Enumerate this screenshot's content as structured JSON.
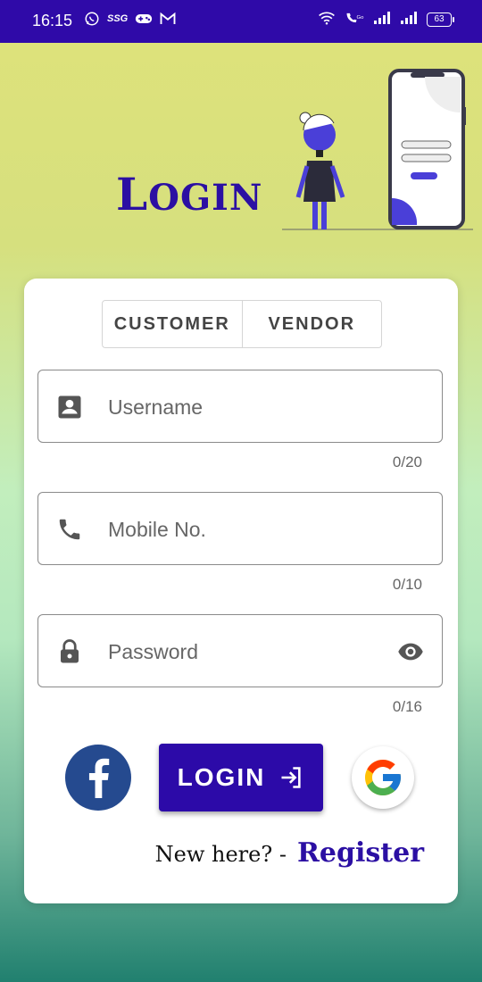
{
  "status_bar": {
    "time": "16:15",
    "left_icons": [
      "whatsapp-icon",
      "ssg-icon",
      "gamepad-icon",
      "gmail-icon"
    ],
    "ssg_text": "SSG",
    "battery": "63"
  },
  "header": {
    "title_first": "L",
    "title_rest": "OGIN"
  },
  "tabs": {
    "customer": "CUSTOMER",
    "vendor": "VENDOR"
  },
  "form": {
    "username": {
      "placeholder": "Username",
      "value": "",
      "counter": "0/20",
      "icon": "account-box-icon"
    },
    "mobile": {
      "placeholder": "Mobile No.",
      "value": "",
      "counter": "0/10",
      "icon": "phone-icon"
    },
    "password": {
      "placeholder": "Password",
      "value": "",
      "counter": "0/16",
      "icon": "lock-icon"
    }
  },
  "actions": {
    "login_label": "LOGIN",
    "new_here": "New here? -",
    "register": "Register"
  },
  "colors": {
    "primary": "#2c0aa8",
    "status_bar": "#2f0aa8",
    "facebook": "#254a8f"
  }
}
